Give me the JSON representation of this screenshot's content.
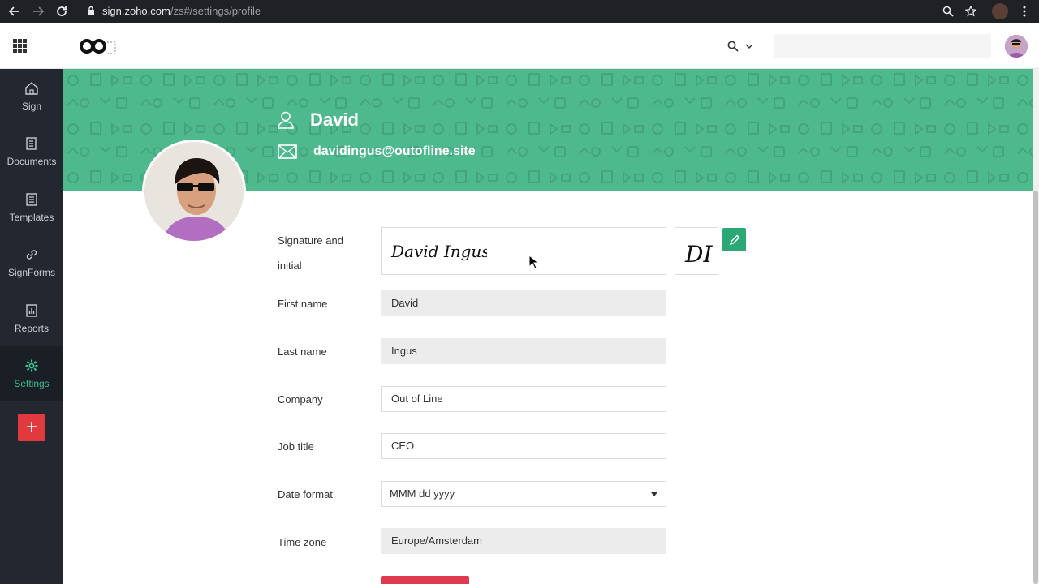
{
  "browser": {
    "url_host": "sign.zoho.com",
    "url_path": "/zs#/settings/profile"
  },
  "sidebar": {
    "items": [
      {
        "label": "Sign",
        "icon": "home-icon"
      },
      {
        "label": "Documents",
        "icon": "documents-icon"
      },
      {
        "label": "Templates",
        "icon": "templates-icon"
      },
      {
        "label": "SignForms",
        "icon": "link-icon"
      },
      {
        "label": "Reports",
        "icon": "reports-icon"
      },
      {
        "label": "Settings",
        "icon": "gear-icon",
        "active": true
      }
    ],
    "add_label": "+"
  },
  "profile": {
    "name": "David",
    "email": "davidingus@outofline.site"
  },
  "form": {
    "signature_label_1": "Signature and",
    "signature_label_2": "initial",
    "signature_text": "David Ingus",
    "initial_text": "DI",
    "first_name_label": "First name",
    "first_name_value": "David",
    "last_name_label": "Last name",
    "last_name_value": "Ingus",
    "company_label": "Company",
    "company_value": "Out of Line",
    "job_title_label": "Job title",
    "job_title_value": "CEO",
    "date_format_label": "Date format",
    "date_format_value": "MMM dd yyyy",
    "time_zone_label": "Time zone",
    "time_zone_value": "Europe/Amsterdam"
  },
  "colors": {
    "banner": "#4fb98e",
    "sidebar": "#222730",
    "accent": "#3fbd8e",
    "danger": "#e03a3f"
  }
}
